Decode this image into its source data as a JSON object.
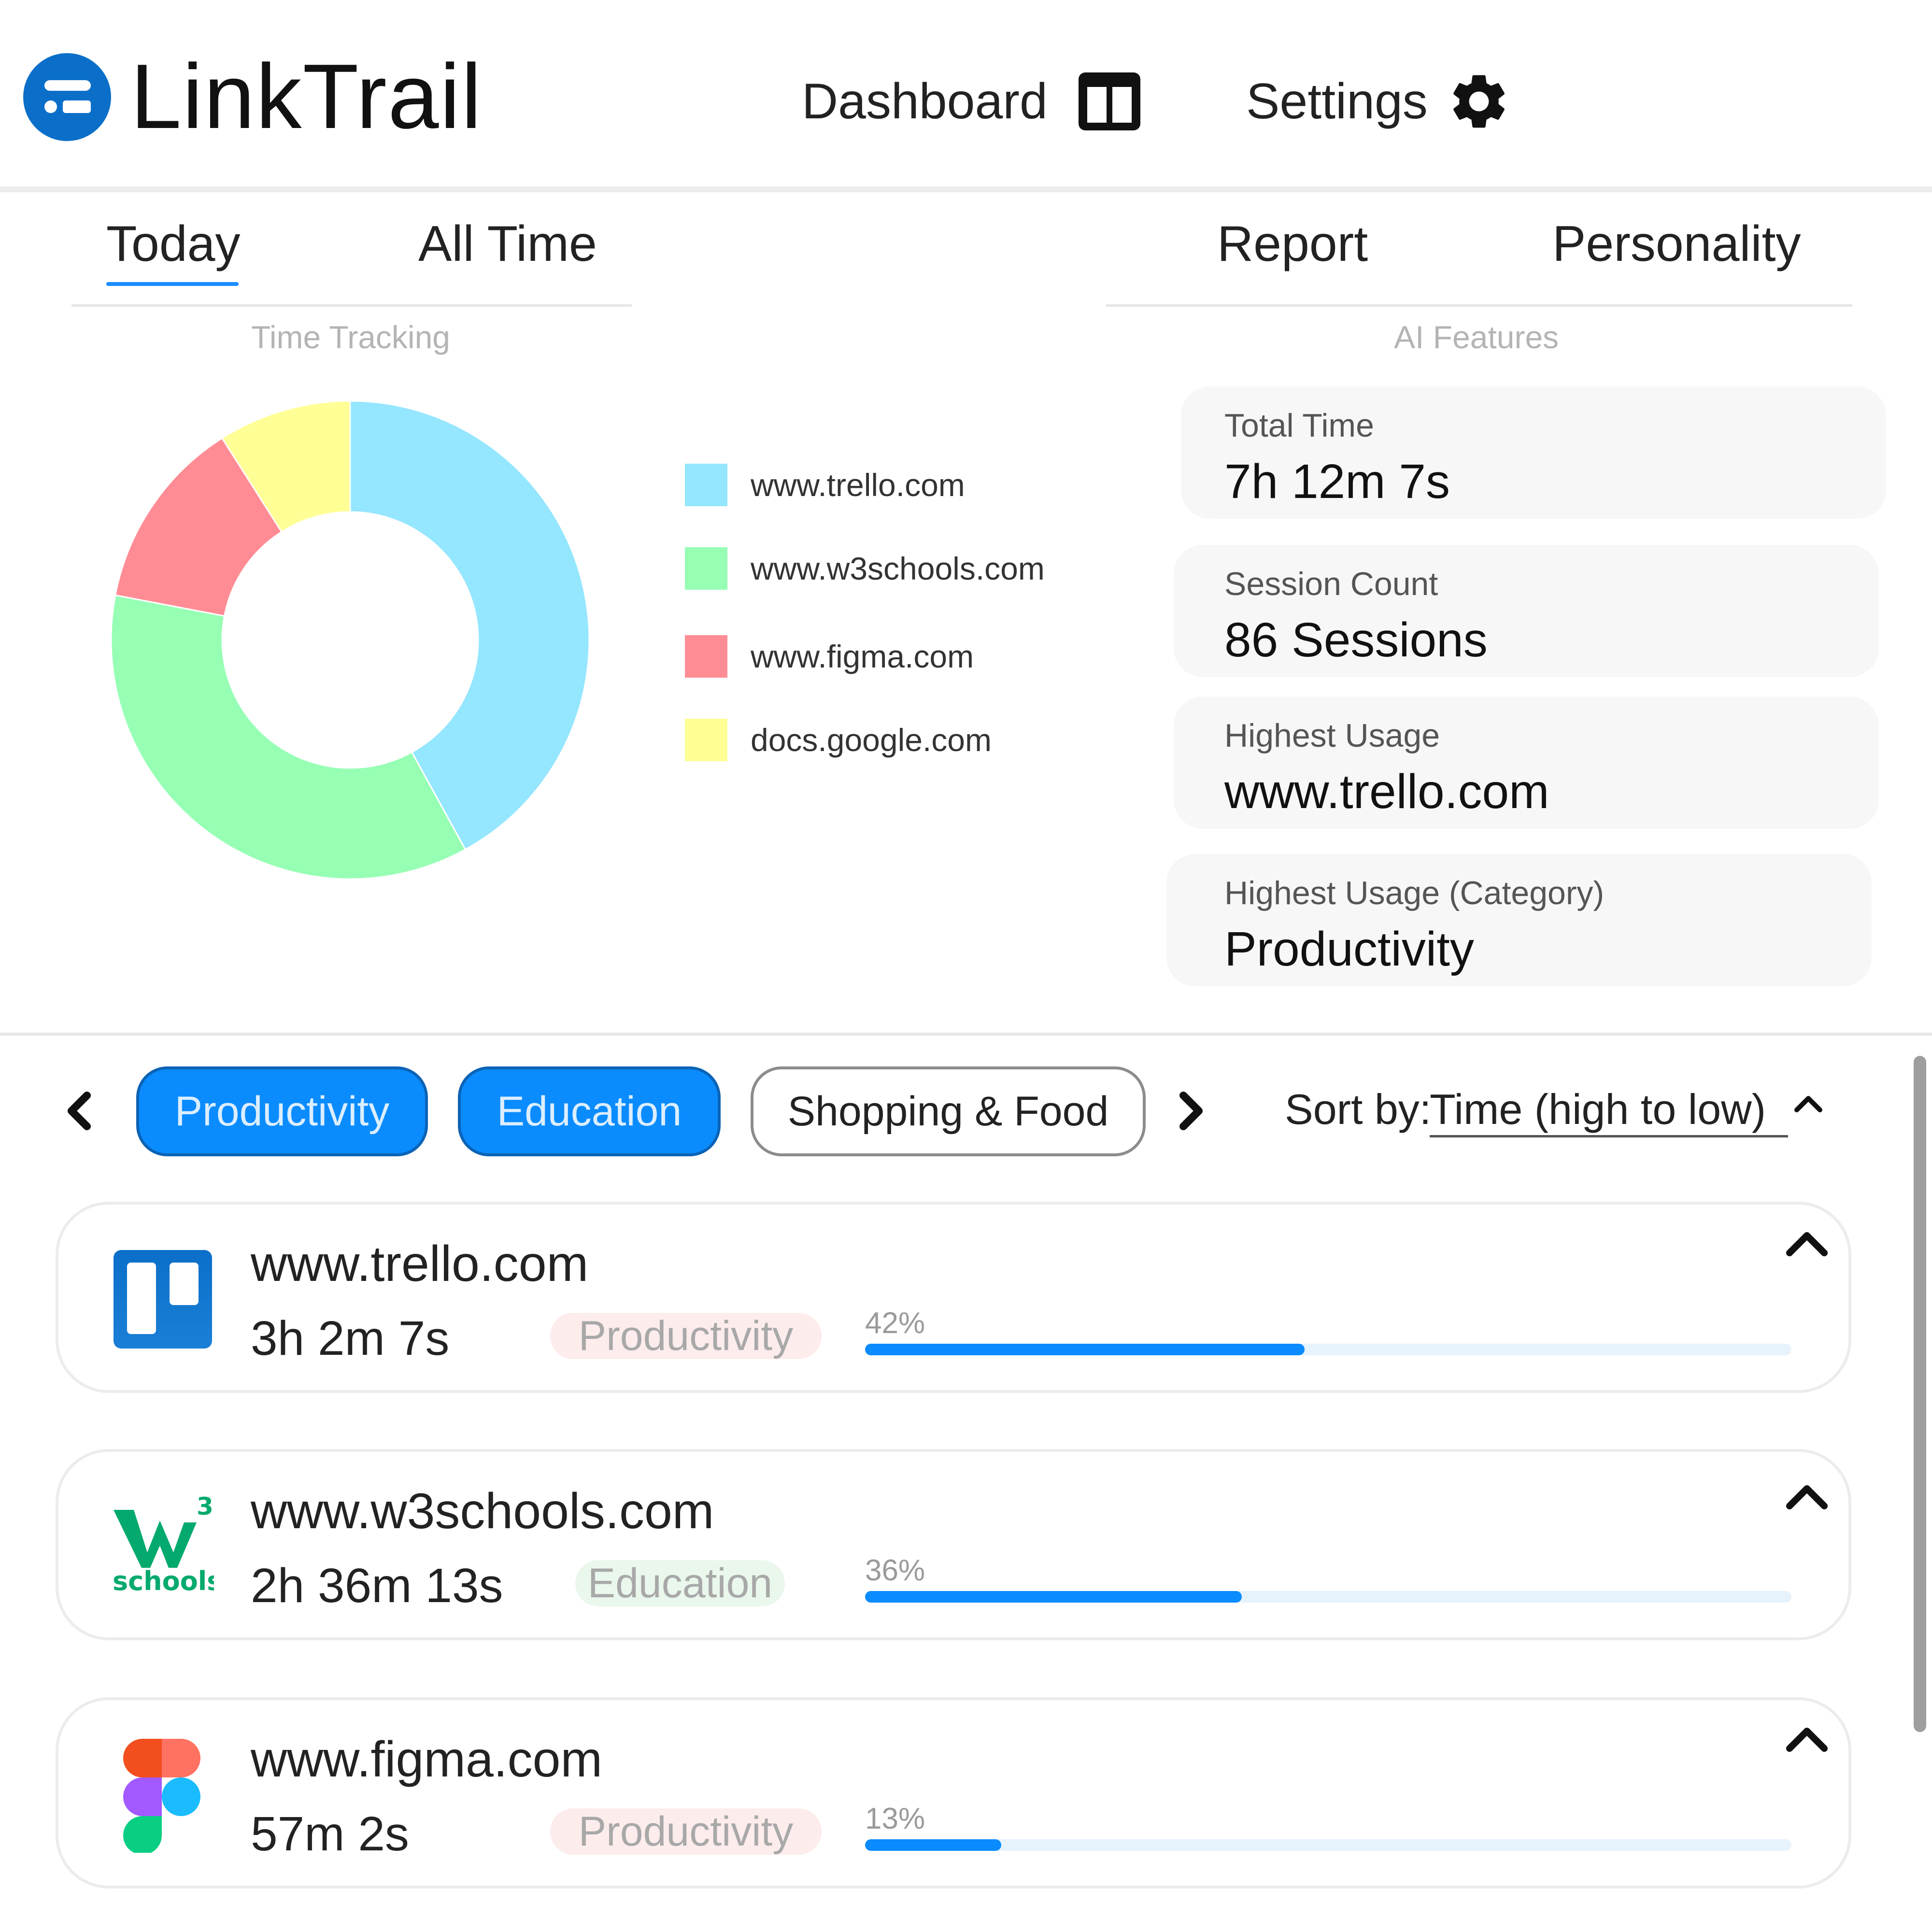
{
  "app": {
    "title": "LinkTrail",
    "nav": {
      "dashboard_label": "Dashboard",
      "settings_label": "Settings"
    }
  },
  "tabs": {
    "left": [
      {
        "label": "Today",
        "active": true
      },
      {
        "label": "All Time",
        "active": false
      }
    ],
    "right": [
      {
        "label": "Report"
      },
      {
        "label": "Personality"
      }
    ],
    "left_caption": "Time Tracking",
    "right_caption": "AI Features"
  },
  "chart_data": {
    "type": "pie",
    "donut": true,
    "categories": [
      "www.trello.com",
      "www.w3schools.com",
      "www.figma.com",
      "docs.google.com"
    ],
    "values": [
      42,
      36,
      13,
      9
    ],
    "colors": [
      "#95e6ff",
      "#96ffb4",
      "#ff8c94",
      "#ffff96"
    ],
    "legend": "right"
  },
  "stats": [
    {
      "label": "Total Time",
      "value": "7h 12m 7s"
    },
    {
      "label": "Session Count",
      "value": "86 Sessions"
    },
    {
      "label": "Highest Usage",
      "value": "www.trello.com"
    },
    {
      "label": "Highest Usage (Category)",
      "value": "Productivity"
    }
  ],
  "filters": {
    "chips": [
      {
        "label": "Productivity",
        "active": true
      },
      {
        "label": "Education",
        "active": true
      },
      {
        "label": "Shopping & Food",
        "active": false
      }
    ],
    "sort_label": "Sort by:",
    "sort_value": "Time (high to low)"
  },
  "sites": [
    {
      "name": "www.trello.com",
      "time": "3h 2m 7s",
      "category": "Productivity",
      "percent_label": "42%",
      "percent": 42,
      "logo": "trello-logo-icon"
    },
    {
      "name": "www.w3schools.com",
      "time": "2h 36m 13s",
      "category": "Education",
      "percent_label": "36%",
      "percent": 36,
      "logo": "w3schools-logo-icon",
      "logo_text": "schools",
      "logo_sup": "3"
    },
    {
      "name": "www.figma.com",
      "time": "57m 2s",
      "category": "Productivity",
      "percent_label": "13%",
      "percent": 13,
      "logo": "figma-logo-icon"
    }
  ],
  "colors": {
    "accent": "#0a8cff",
    "brand": "#0b6fc9"
  }
}
